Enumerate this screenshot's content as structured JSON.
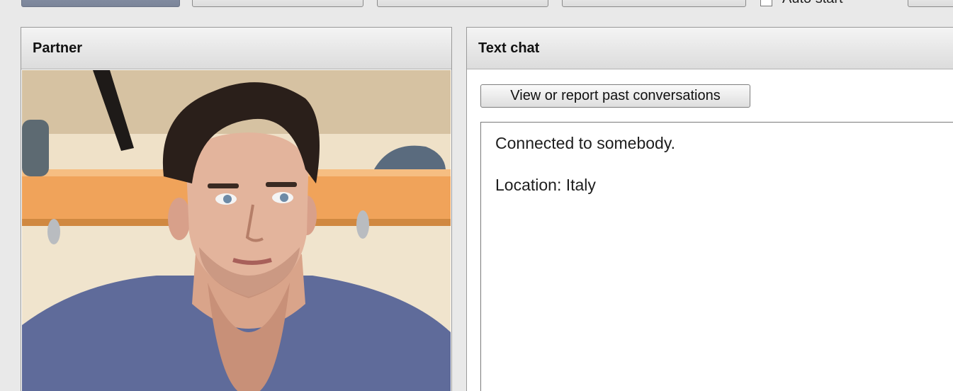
{
  "toolbar": {
    "autostart_label": "Auto start",
    "autostart_checked": false
  },
  "partner_panel": {
    "title": "Partner"
  },
  "chat_panel": {
    "title": "Text chat",
    "view_report_label": "View or report past conversations",
    "messages": [
      "Connected to somebody.",
      "Location: Italy"
    ]
  },
  "colors": {
    "panel_border": "#9a9a9a",
    "header_gradient_top": "#f4f4f4",
    "header_gradient_bottom": "#dcdcdc",
    "active_tab": "#7b8599",
    "page_background": "#e9e9e9"
  }
}
